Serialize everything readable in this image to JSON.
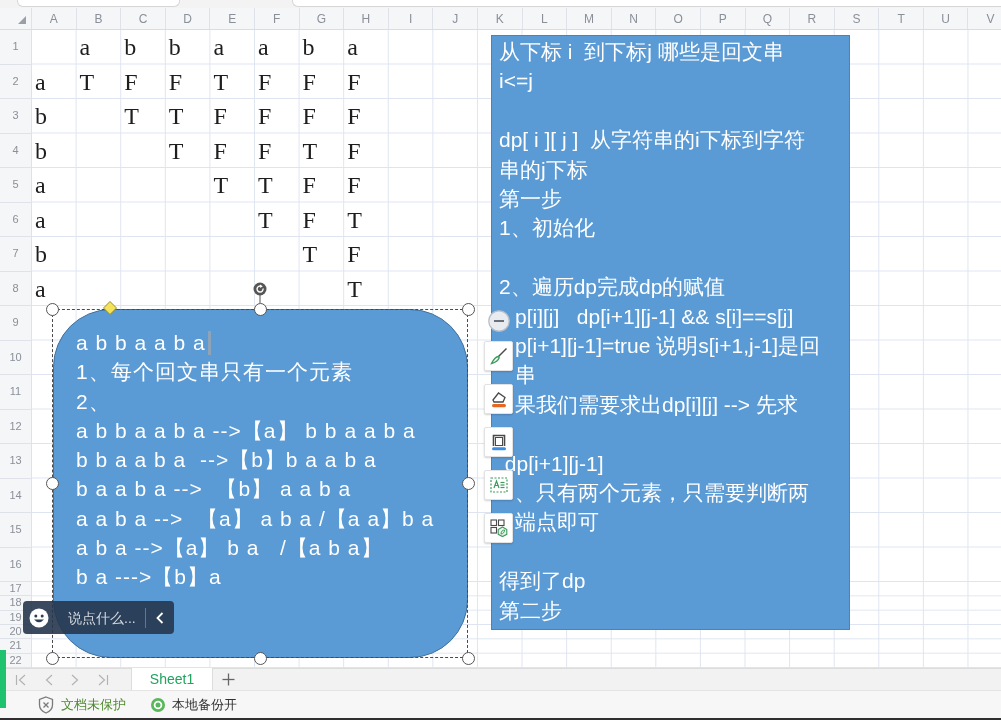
{
  "sheet": {
    "columns": [
      "A",
      "B",
      "C",
      "D",
      "E",
      "F",
      "G",
      "H",
      "I",
      "J",
      "K",
      "L",
      "M",
      "N",
      "O",
      "P",
      "Q",
      "R",
      "S",
      "T",
      "U",
      "V"
    ],
    "rows": [
      {
        "label": "1",
        "cells": [
          null,
          "a",
          "b",
          "b",
          "a",
          "a",
          "b",
          "a"
        ]
      },
      {
        "label": "2",
        "cells": [
          "a",
          "T",
          "F",
          "F",
          "T",
          "F",
          "F",
          "F"
        ]
      },
      {
        "label": "3",
        "cells": [
          "b",
          null,
          "T",
          "T",
          "F",
          "F",
          "F",
          "F"
        ]
      },
      {
        "label": "4",
        "cells": [
          "b",
          null,
          null,
          "T",
          "F",
          "F",
          "T",
          "F"
        ]
      },
      {
        "label": "5",
        "cells": [
          "a",
          null,
          null,
          null,
          "T",
          "T",
          "F",
          "F"
        ]
      },
      {
        "label": "6",
        "cells": [
          "a",
          null,
          null,
          null,
          null,
          "T",
          "F",
          "T"
        ]
      },
      {
        "label": "7",
        "cells": [
          "b",
          null,
          null,
          null,
          null,
          null,
          "T",
          "F"
        ]
      },
      {
        "label": "8",
        "cells": [
          "a",
          null,
          null,
          null,
          null,
          null,
          null,
          "T"
        ]
      },
      {
        "label": "9"
      },
      {
        "label": "10"
      },
      {
        "label": "11"
      },
      {
        "label": "12"
      },
      {
        "label": "13"
      },
      {
        "label": "14"
      },
      {
        "label": "15"
      },
      {
        "label": "16"
      },
      {
        "label": "17"
      },
      {
        "label": "18"
      },
      {
        "label": "19"
      },
      {
        "label": "20"
      },
      {
        "label": "21"
      },
      {
        "label": "22"
      }
    ]
  },
  "text_box": {
    "paragraphs": [
      {
        "lines": [
          {
            "kind": "full",
            "text": "从下标 i  到下标j 哪些是回文串"
          },
          {
            "kind": "full",
            "text": "i<=j"
          }
        ]
      },
      {
        "lines": [
          {
            "kind": "full",
            "text": "dp[ i ][ j ]  从字符串的i下标到字符"
          },
          {
            "kind": "full",
            "text": "串的j下标"
          },
          {
            "kind": "full",
            "text": "第一步"
          },
          {
            "kind": "full",
            "text": "1、初始化"
          }
        ]
      },
      {
        "lines": [
          {
            "kind": "full",
            "text": "2、遍历dp完成dp的赋值"
          },
          {
            "kind": "clipped",
            "text": "p[i][j]   dp[i+1][j-1] && s[i]==s[j]"
          },
          {
            "kind": "clipped",
            "text": "p[i+1][j-1]=true 说明s[i+1,j-1]是回"
          },
          {
            "kind": "clipped",
            "text": "串"
          },
          {
            "kind": "clipped",
            "text": "果我们需要求出dp[i][j] --> 先求"
          }
        ]
      },
      {
        "lines": [
          {
            "kind": "full",
            "text": " dp[i+1][j-1]"
          },
          {
            "kind": "clipped",
            "text": "、只有两个元素，只需要判断两"
          },
          {
            "kind": "clipped",
            "text": "端点即可"
          }
        ]
      },
      {
        "lines": [
          {
            "kind": "full",
            "text": "得到了dp"
          },
          {
            "kind": "full",
            "text": "第二步"
          }
        ]
      }
    ]
  },
  "side_toolbar": {
    "tools": [
      {
        "kind": "collapse"
      },
      {
        "kind": "brush"
      },
      {
        "kind": "fill"
      },
      {
        "kind": "outline"
      },
      {
        "kind": "text_box"
      },
      {
        "kind": "apps"
      }
    ]
  },
  "rounded_shape": {
    "selected": true,
    "lines": [
      {
        "text": "a b b a a b a",
        "cursor": true
      },
      {
        "text": "1、每个回文串只有一个元素",
        "cursor": false
      },
      {
        "text": "2、",
        "cursor": false
      },
      {
        "text": "a b b a a b a -->【a】 b b a a b a",
        "cursor": false
      },
      {
        "text": "b b a a b a  -->【b】b a a b a",
        "cursor": false
      },
      {
        "text": "b a a b a -->  【b】 a a b a",
        "cursor": false
      },
      {
        "text": "a a b a -->  【a】 a b a /【a a】b a",
        "cursor": false
      },
      {
        "text": "a b a -->【a】 b a   /【a b a】",
        "cursor": false
      },
      {
        "text": "b a --->【b】a",
        "cursor": false
      }
    ]
  },
  "comment_bar": {
    "placeholder": "说点什么..."
  },
  "sheet_tabs": {
    "tabs": [
      {
        "label": "Sheet1",
        "selected": true
      }
    ]
  },
  "status_bar": {
    "items": [
      {
        "kind": "protection",
        "label": "文档未保护"
      },
      {
        "kind": "backup",
        "label": "本地备份开"
      }
    ]
  }
}
